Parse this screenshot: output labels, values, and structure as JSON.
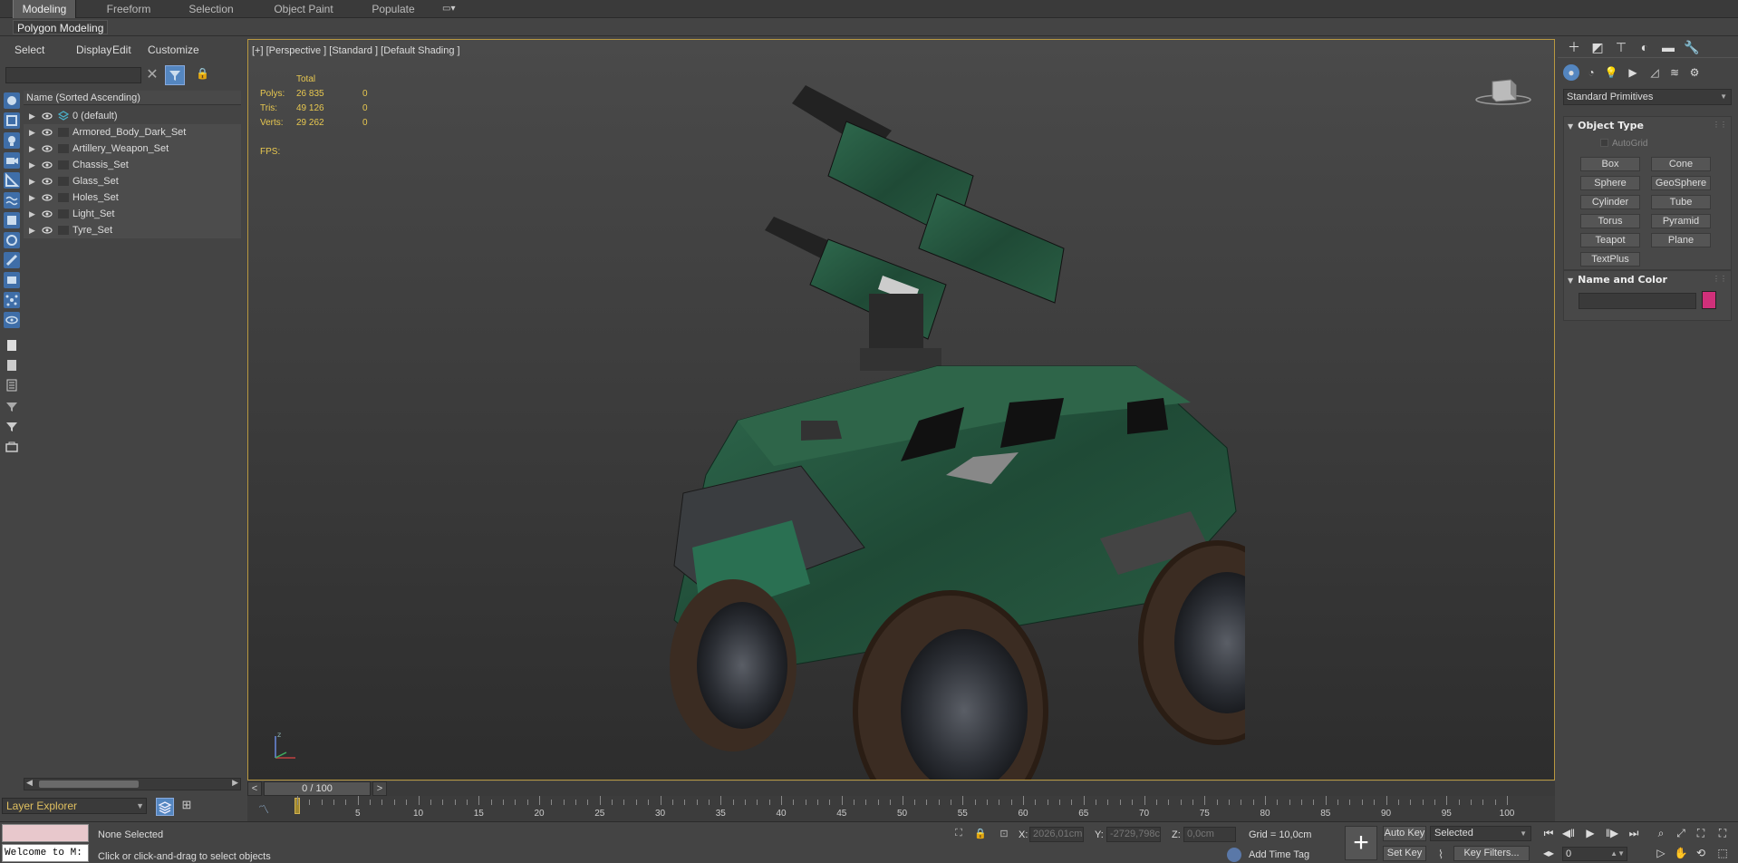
{
  "ribbon": {
    "tabs": [
      "Modeling",
      "Freeform",
      "Selection",
      "Object Paint",
      "Populate"
    ],
    "active": "Modeling",
    "sub_label": "Polygon Modeling"
  },
  "explorer": {
    "menu": [
      "Select",
      "Display",
      "Edit",
      "Customize"
    ],
    "header": "Name (Sorted Ascending)",
    "layers": [
      "0 (default)",
      "Armored_Body_Dark_Set",
      "Artillery_Weapon_Set",
      "Chassis_Set",
      "Glass_Set",
      "Holes_Set",
      "Light_Set",
      "Tyre_Set"
    ],
    "layer_explorer_label": "Layer Explorer"
  },
  "viewport": {
    "label": "[+] [Perspective ] [Standard ] [Default Shading ]",
    "stats": {
      "total_header": "Total",
      "rows": [
        {
          "key": "Polys:",
          "value": "26 835",
          "selected": "0"
        },
        {
          "key": "Tris:",
          "value": "49 126",
          "selected": "0"
        },
        {
          "key": "Verts:",
          "value": "29 262",
          "selected": "0"
        }
      ],
      "fps_label": "FPS:"
    }
  },
  "timeline": {
    "slider_label": "0 / 100",
    "prev": "<",
    "next": ">",
    "ticks": [
      5,
      10,
      15,
      20,
      25,
      30,
      35,
      40,
      45,
      50,
      55,
      60,
      65,
      70,
      75,
      80,
      85,
      90,
      95,
      100
    ],
    "start": 0,
    "end": 100,
    "current": 0
  },
  "status": {
    "maxscript_text": "Welcome to M:",
    "none_selected": "None Selected",
    "hint": "Click or click-and-drag to select objects",
    "x_label": "X:",
    "x_value": "2026,01cm",
    "y_label": "Y:",
    "y_value": "-2729,798c",
    "z_label": "Z:",
    "z_value": "0,0cm",
    "grid": "Grid = 10,0cm",
    "add_time_tag": "Add Time Tag",
    "auto_key": "Auto Key",
    "set_key": "Set Key",
    "selected": "Selected",
    "key_filters": "Key Filters...",
    "frame": "0"
  },
  "command_panel": {
    "dropdown": "Standard Primitives",
    "object_type_title": "Object Type",
    "autogrid": "AutoGrid",
    "primitives": [
      "Box",
      "Cone",
      "Sphere",
      "GeoSphere",
      "Cylinder",
      "Tube",
      "Torus",
      "Pyramid",
      "Teapot",
      "Plane",
      "TextPlus"
    ],
    "name_color_title": "Name and Color",
    "swatch_color": "#d0307a"
  },
  "colors": {
    "accent_blue": "#5486c0",
    "viewport_border": "#b89840",
    "stats_text": "#e8c850"
  }
}
